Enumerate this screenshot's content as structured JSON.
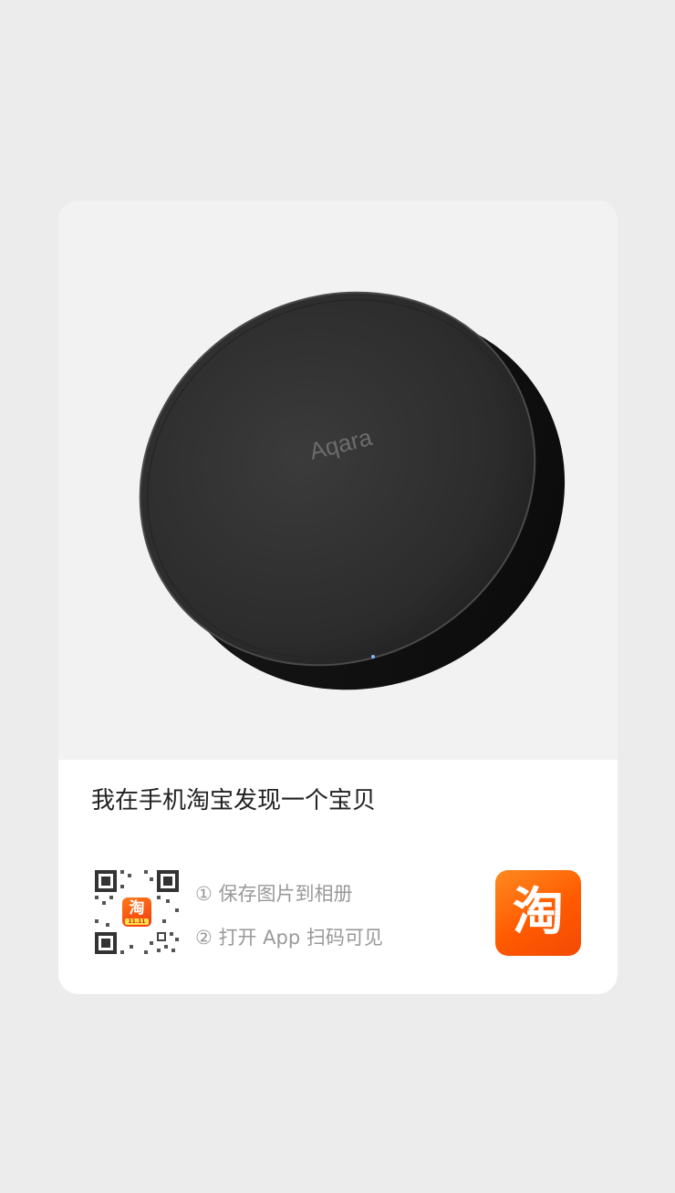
{
  "share_card": {
    "title": "我在手机淘宝发现一个宝贝",
    "product_image": {
      "subject": "black round smart hub",
      "brand_mark": "Aqara"
    },
    "qr": {
      "center_badge_glyph": "淘",
      "center_badge_date": "11.11"
    },
    "steps": [
      {
        "label": "① 保存图片到相册"
      },
      {
        "label": "② 打开 App 扫码可见"
      }
    ],
    "app_logo": {
      "glyph": "淘",
      "icon": "taobao-app-icon"
    }
  },
  "colors": {
    "page_background": "#ececec",
    "card_background": "#ffffff",
    "title_text": "#222222",
    "hint_text": "#999999",
    "taobao_orange": "#ff5a00"
  }
}
